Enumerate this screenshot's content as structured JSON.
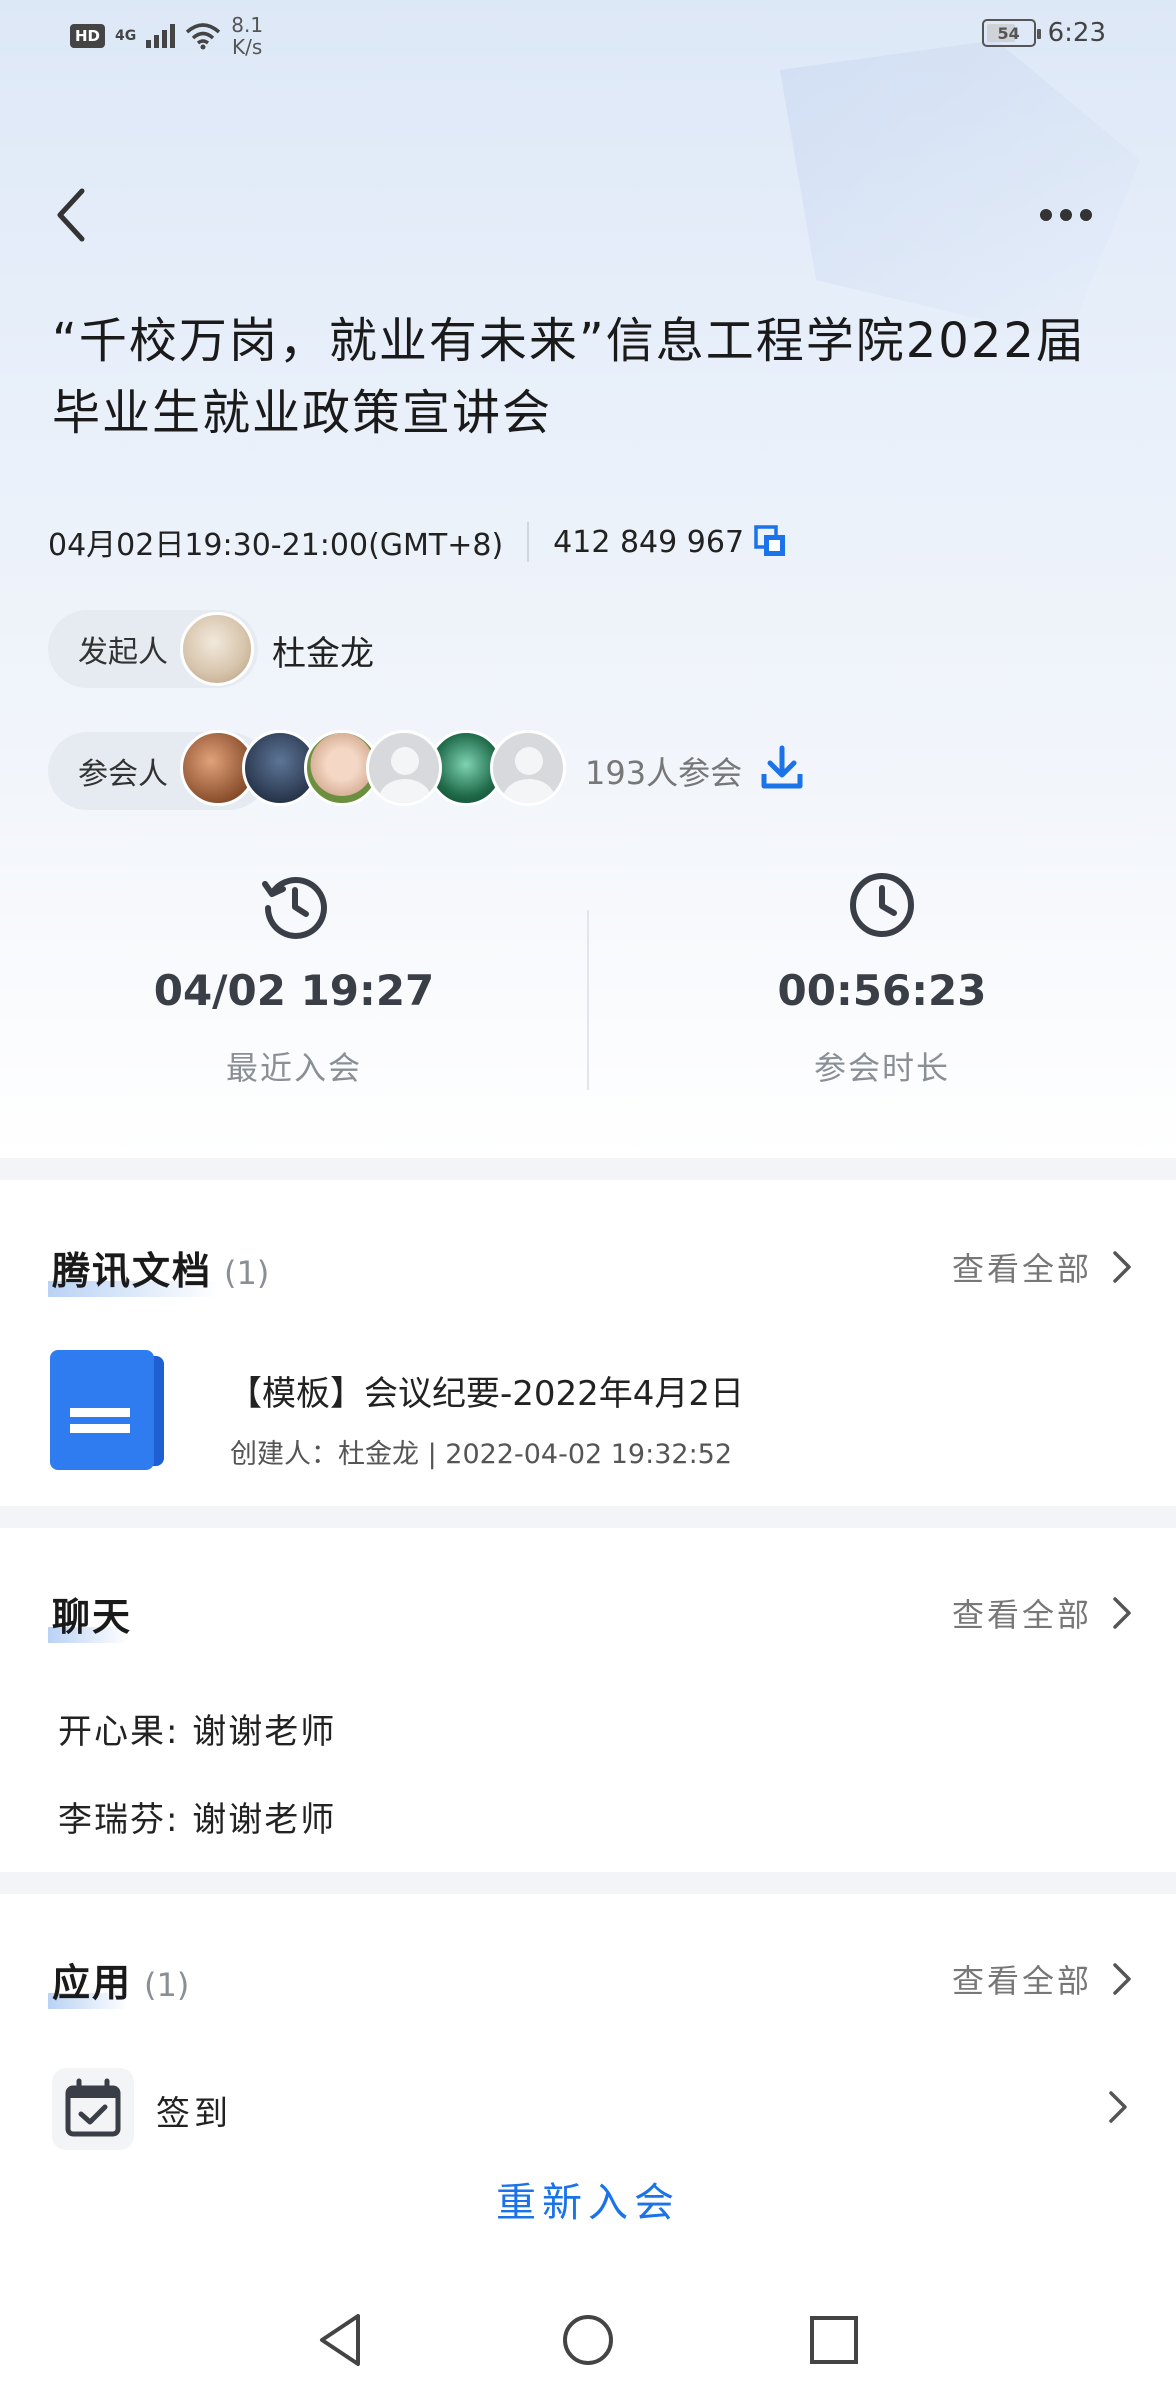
{
  "statusbar": {
    "hd": "HD",
    "network": "4G",
    "speed_value": "8.1",
    "speed_unit": "K/s",
    "battery": "54",
    "time": "6:23"
  },
  "meeting": {
    "title": "“千校万岗，就业有未来”信息工程学院2022届毕业生就业政策宣讲会",
    "time": "04月02日19:30-21:00(GMT+8)",
    "meeting_id": "412 849 967"
  },
  "host": {
    "label": "发起人",
    "name": "杜金龙"
  },
  "participants": {
    "label": "参会人",
    "count_text": "193人参会"
  },
  "stats": {
    "recent_join_value": "04/02 19:27",
    "recent_join_label": "最近入会",
    "duration_value": "00:56:23",
    "duration_label": "参会时长"
  },
  "docs": {
    "title": "腾讯文档",
    "count": "(1)",
    "view_all": "查看全部",
    "items": [
      {
        "name": "【模板】会议纪要-2022年4月2日",
        "meta": "创建人：杜金龙 | 2022-04-02 19:32:52"
      }
    ]
  },
  "chat": {
    "title": "聊天",
    "view_all": "查看全部",
    "messages": [
      {
        "text": "开心果: 谢谢老师"
      },
      {
        "text": "李瑞芬: 谢谢老师"
      }
    ]
  },
  "apps": {
    "title": "应用",
    "count": "(1)",
    "view_all": "查看全部",
    "items": [
      {
        "label": "签到",
        "icon": "calendar-check-icon"
      }
    ]
  },
  "actions": {
    "rejoin": "重新入会"
  },
  "colors": {
    "accent": "#1a73e8",
    "doc_blue": "#2f7bf0"
  }
}
